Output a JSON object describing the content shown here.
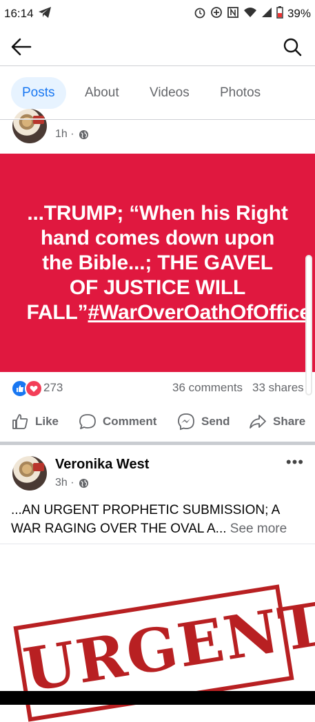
{
  "statusbar": {
    "time": "16:14",
    "battery": "39%",
    "icons": [
      "telegram-icon",
      "alarm-icon",
      "data-saver-icon",
      "nfc-icon",
      "wifi-icon",
      "signal-icon",
      "battery-icon"
    ]
  },
  "header": {
    "back_icon": "arrow-left-icon",
    "search_icon": "search-icon"
  },
  "tabs": [
    {
      "label": "Posts",
      "active": true
    },
    {
      "label": "About",
      "active": false
    },
    {
      "label": "Videos",
      "active": false
    },
    {
      "label": "Photos",
      "active": false
    }
  ],
  "post1": {
    "time": "1h ·",
    "banner_line": "...TRUMP; “When his Right hand comes down upon the Bible...; THE GAVEL OF JUSTICE WILL FALL”",
    "hashtag": "#WarOverOathOfOffice",
    "banner_color": "#e0183f",
    "reactions_count": "273",
    "comments": "36 comments",
    "shares": "33 shares",
    "actions": {
      "like": "Like",
      "comment": "Comment",
      "send": "Send",
      "share": "Share"
    }
  },
  "post2": {
    "author": "Veronika West",
    "time": "3h ·",
    "text": "...AN URGENT PROPHETIC SUBMISSION; A WAR RAGING OVER THE OVAL A...",
    "see_more": "See more",
    "image_stamp": "URGENT",
    "more_icon": "more-dots-icon"
  },
  "colors": {
    "accent": "#1877f2",
    "tab_active_bg": "#e7f3ff",
    "muted": "#65676b",
    "love": "#f33e58",
    "stamp": "#b82022"
  }
}
